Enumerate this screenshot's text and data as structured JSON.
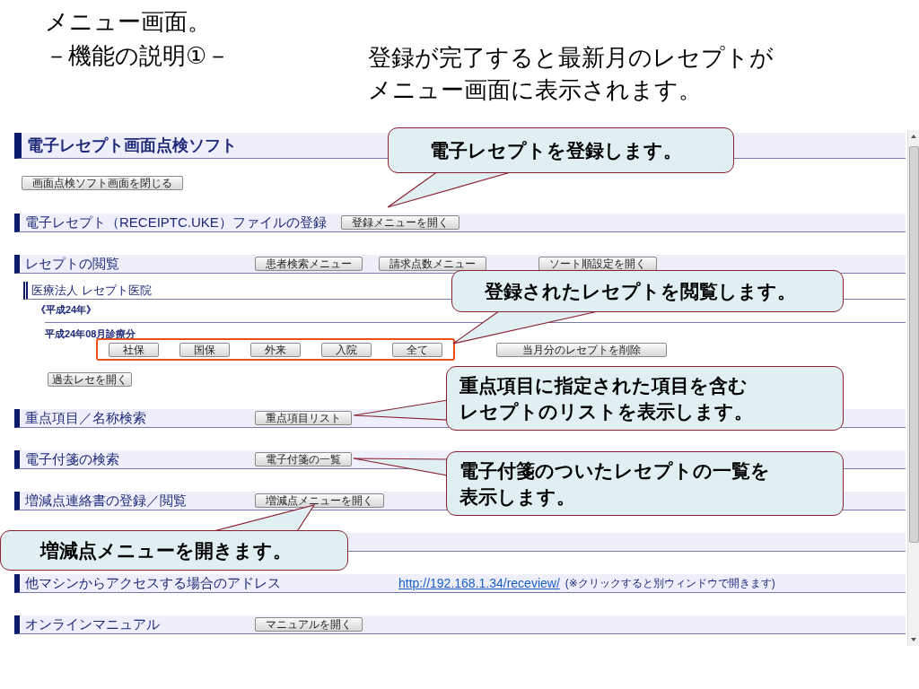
{
  "slide": {
    "title": "メニュー画面。",
    "subtitle": "－機能の説明①－",
    "description": [
      "登録が完了すると最新月のレセプトが",
      "メニュー画面に表示されます。"
    ]
  },
  "app": {
    "title": "電子レセプト画面点検ソフト",
    "close_button": "画面点検ソフト画面を閉じる",
    "sections": [
      {
        "kind": "section",
        "title": "電子レセプト（RECEIPTC.UKE）ファイルの登録",
        "buttons": [
          "登録メニューを開く"
        ]
      },
      {
        "kind": "browse",
        "title": "レセプトの閲覧",
        "buttons": [
          "患者検索メニュー",
          "請求点数メニュー",
          "ソート順設定を開く"
        ],
        "clinic": "医療法人 レセプト医院",
        "year": "《平成24年》",
        "month": "平成24年08月診療分",
        "filters": [
          "社保",
          "国保",
          "外来",
          "入院",
          "全て"
        ],
        "delete_button": "当月分のレセプトを削除",
        "past_button": "過去レセを開く"
      },
      {
        "kind": "section",
        "title": "重点項目／名称検索",
        "buttons": [
          "重点項目リスト"
        ]
      },
      {
        "kind": "section",
        "title": "電子付箋の検索",
        "buttons": [
          "電子付箋の一覧"
        ]
      },
      {
        "kind": "section",
        "title": "増減点連絡書の登録／閲覧",
        "buttons": [
          "増減点メニューを開く"
        ]
      },
      {
        "kind": "section"
      },
      {
        "kind": "link",
        "title": "他マシンからアクセスする場合のアドレス",
        "link": "http://192.168.1.34/receview/",
        "note": "(※クリックすると別ウィンドウで開きます)"
      },
      {
        "kind": "section",
        "title": "オンラインマニュアル",
        "buttons": [
          "マニュアルを開く"
        ]
      }
    ]
  },
  "callouts": [
    {
      "text": "電子レセプトを登録します。"
    },
    {
      "text": "登録されたレセプトを閲覧します。"
    },
    {
      "text": "重点項目に指定された項目を含むレセプトのリストを表示します。"
    },
    {
      "text": "電子付箋のついたレセプトの一覧を表示します。"
    },
    {
      "text": "増減点メニューを開きます。"
    }
  ]
}
